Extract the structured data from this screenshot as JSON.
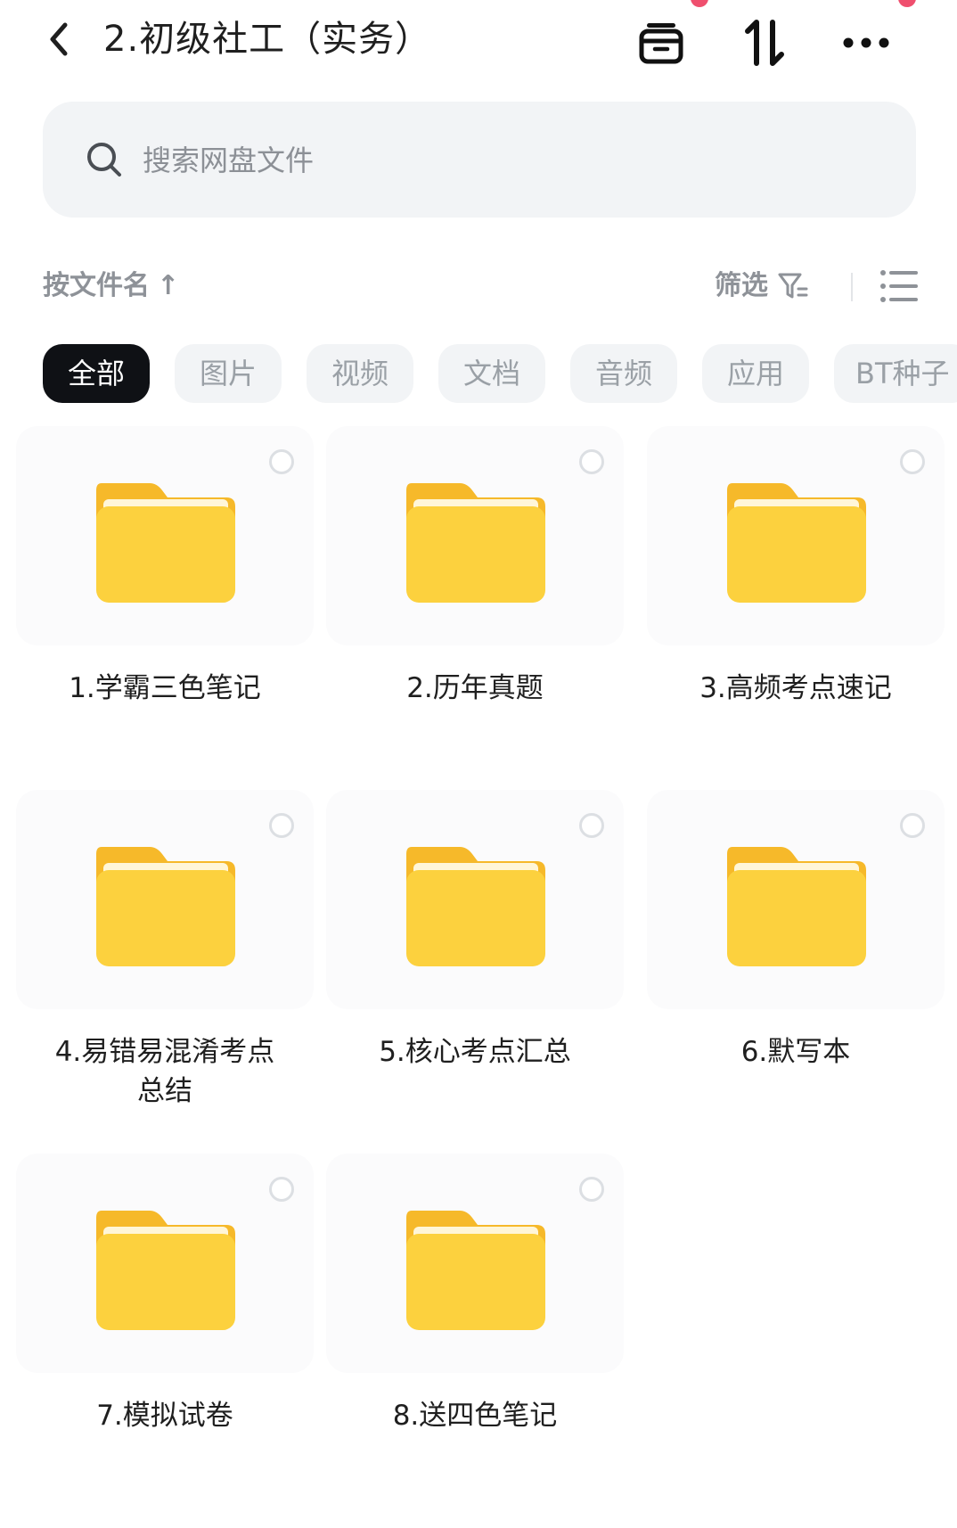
{
  "header": {
    "title": "2.初级社工（实务）",
    "icons": [
      "back-icon",
      "archive-icon",
      "sort-icon",
      "more-icon"
    ]
  },
  "search": {
    "placeholder": "搜索网盘文件",
    "value": ""
  },
  "toolbar": {
    "sort_label": "按文件名",
    "sort_arrow": "↑",
    "filter_label": "筛选"
  },
  "tabs": [
    {
      "label": "全部",
      "active": true
    },
    {
      "label": "图片",
      "active": false
    },
    {
      "label": "视频",
      "active": false
    },
    {
      "label": "文档",
      "active": false
    },
    {
      "label": "音频",
      "active": false
    },
    {
      "label": "应用",
      "active": false
    },
    {
      "label": "BT种子",
      "active": false
    }
  ],
  "files": [
    {
      "name": "1.学霸三色笔记",
      "type": "folder"
    },
    {
      "name": "2.历年真题",
      "type": "folder"
    },
    {
      "name": "3.高频考点速记",
      "type": "folder"
    },
    {
      "name": "4.易错易混淆考点总结",
      "type": "folder"
    },
    {
      "name": "5.核心考点汇总",
      "type": "folder"
    },
    {
      "name": "6.默写本",
      "type": "folder"
    },
    {
      "name": "7.模拟试卷",
      "type": "folder"
    },
    {
      "name": "8.送四色笔记",
      "type": "folder"
    }
  ],
  "colors": {
    "folder_main": "#fcd13e",
    "folder_back": "#f6b92a",
    "active_tab": "#0f1115",
    "notification_dot": "#ef4f6e"
  }
}
